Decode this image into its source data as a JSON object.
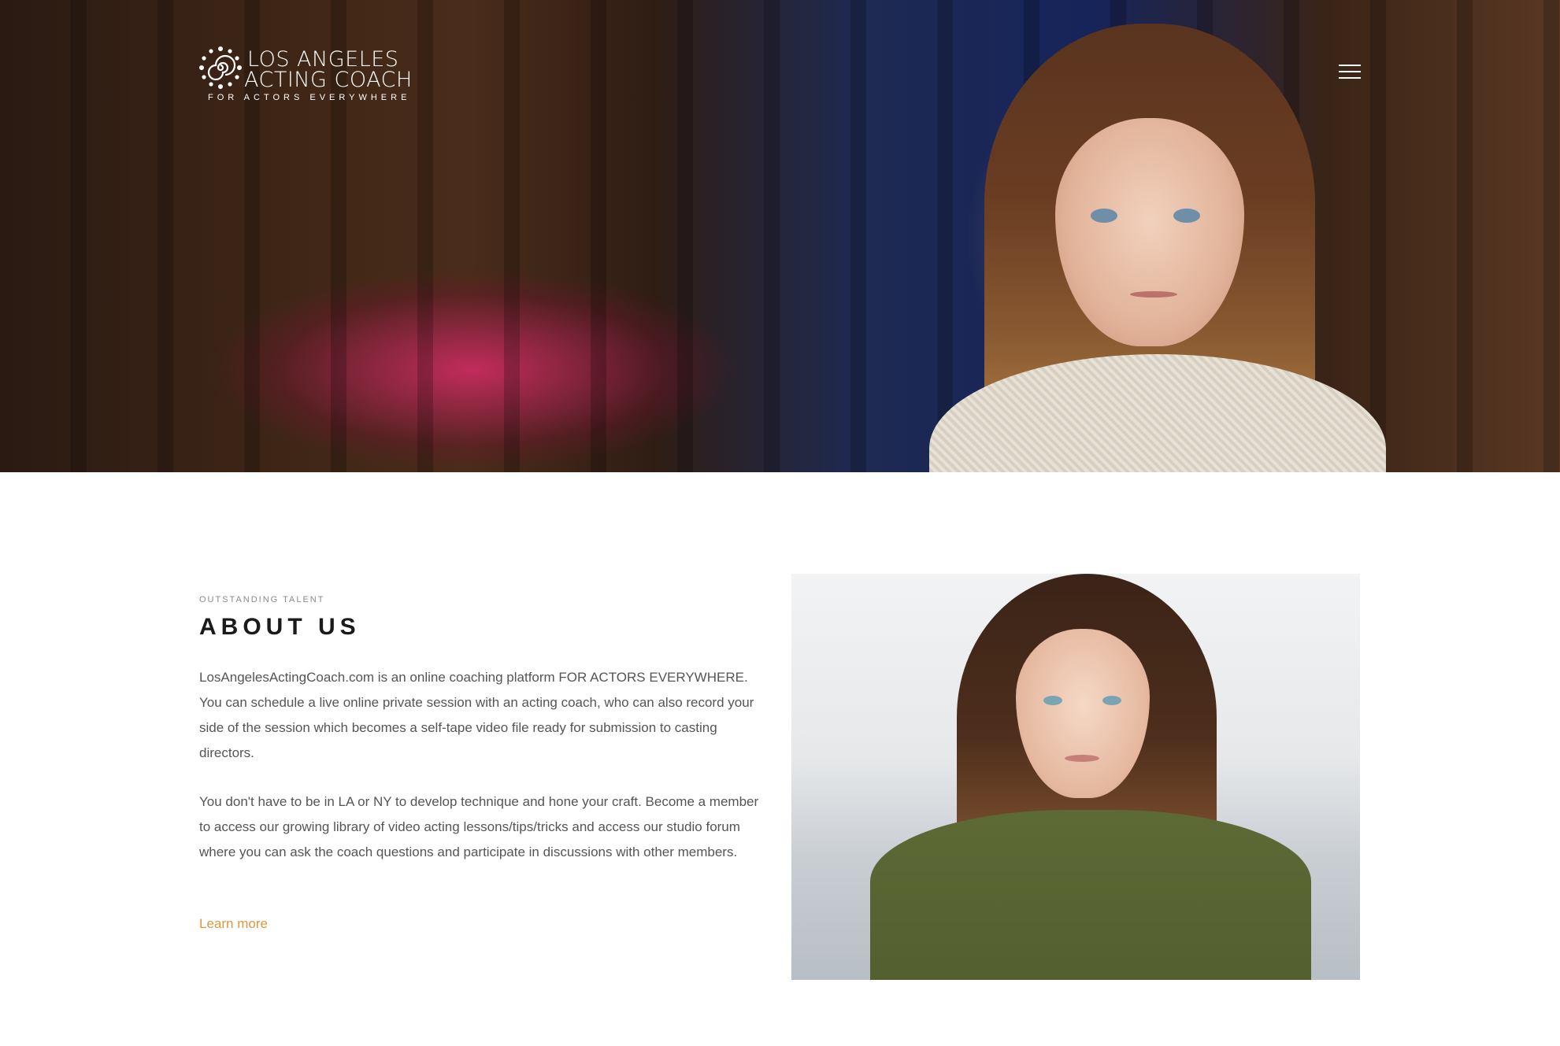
{
  "header": {
    "logo_line1": "LOS ANGELES",
    "logo_line2": "ACTING COACH",
    "logo_tagline": "FOR ACTORS EVERYWHERE",
    "menu_icon": "hamburger-menu-icon"
  },
  "about": {
    "eyebrow": "OUTSTANDING TALENT",
    "heading": "ABOUT US",
    "paragraph1": "LosAngelesActingCoach.com is an online coaching platform FOR ACTORS EVERYWHERE. You can schedule a live online private session with an acting coach, who can also record your side of the session which becomes a self-tape video file ready for submission to casting directors.",
    "paragraph2": "You don't have to be in LA or NY to develop technique and hone your craft. Become a member to access our growing library of video acting lessons/tips/tricks and access our studio forum where you can ask the coach questions and participate in discussions with other members.",
    "link": "Learn more"
  },
  "colors": {
    "accent_link": "#d99a3c",
    "heading": "#1a1a1a",
    "body_text": "#555555"
  }
}
